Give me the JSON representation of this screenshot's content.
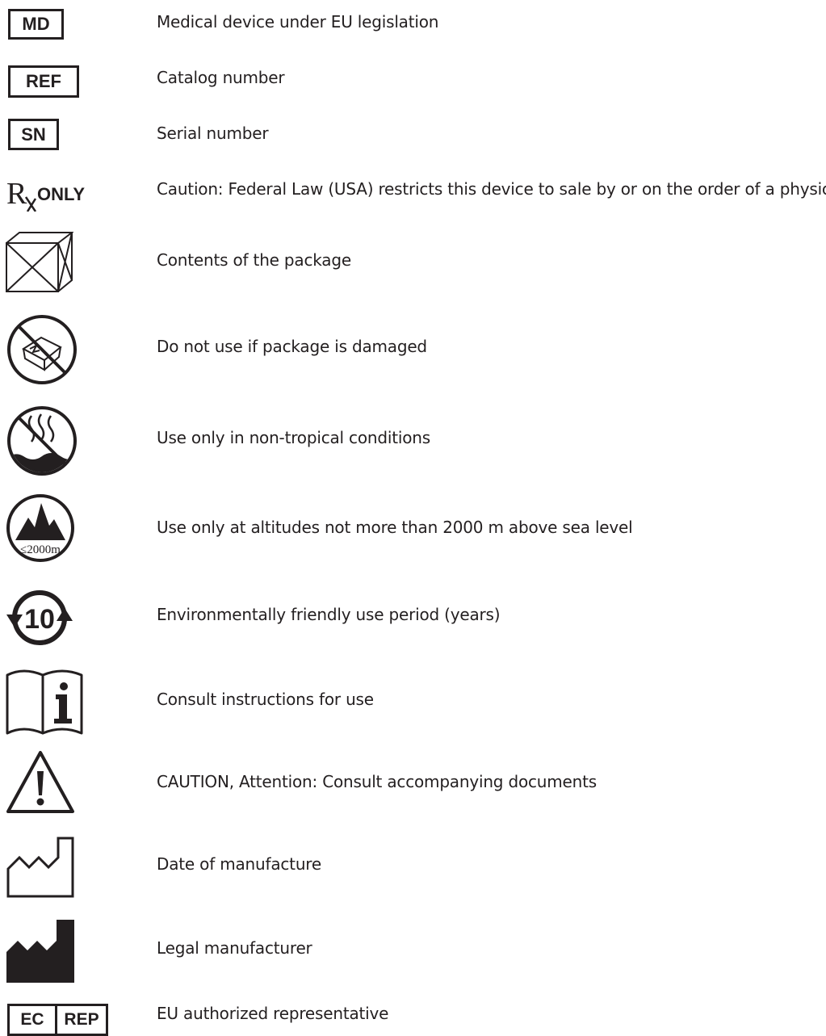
{
  "symbols": [
    {
      "code": "MD",
      "text": "Medical device under EU legislation"
    },
    {
      "code": "REF",
      "text": "Catalog number"
    },
    {
      "code": "SN",
      "text": "Serial number"
    },
    {
      "code": "ONLY",
      "text": "Caution: Federal Law (USA) restricts this device to sale by or on the order of a physician"
    },
    {
      "code": "",
      "text": "Contents of the package"
    },
    {
      "code": "",
      "text": "Do not use if package is damaged"
    },
    {
      "code": "",
      "text": "Use only in non-tropical conditions"
    },
    {
      "code": "≤2000m",
      "text": "Use only at altitudes not more than 2000 m above sea level"
    },
    {
      "code": "10",
      "text": "Environmentally friendly use period (years)"
    },
    {
      "code": "",
      "text": "Consult instructions for use"
    },
    {
      "code": "",
      "text": "CAUTION, Attention: Consult accompanying documents"
    },
    {
      "code": "",
      "text": "Date of manufacture"
    },
    {
      "code": "",
      "text": "Legal manufacturer"
    },
    {
      "code": "EC",
      "code2": "REP",
      "text": "EU authorized representative"
    }
  ]
}
